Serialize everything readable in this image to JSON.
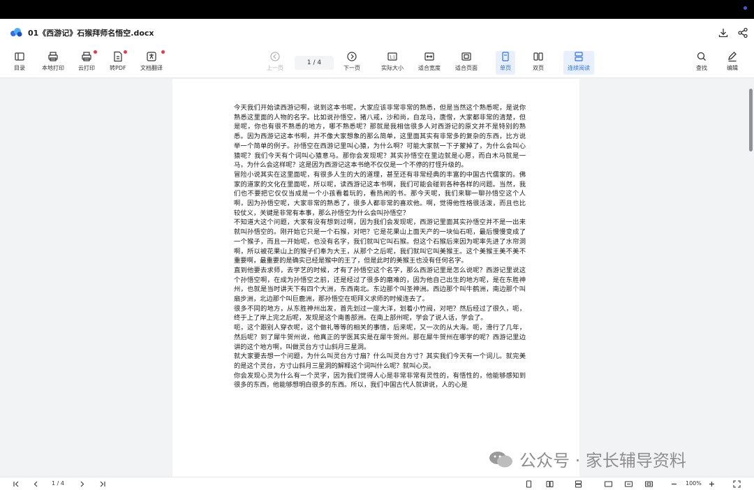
{
  "window": {
    "title": "01《西游记》石猴拜师名悟空.docx"
  },
  "toolbar": {
    "left": [
      {
        "label": "目录",
        "icon": "toc-icon"
      },
      {
        "label": "本地打印",
        "icon": "printer-icon"
      },
      {
        "label": "云打印",
        "icon": "cloud-print-icon"
      },
      {
        "label": "转PDF",
        "icon": "pdf-icon"
      },
      {
        "label": "文档翻译",
        "icon": "translate-icon"
      }
    ],
    "nav": {
      "prev_label": "上一页",
      "page_indicator": "1 / 4",
      "next_label": "下一页"
    },
    "view": [
      {
        "label": "实际大小",
        "icon": "actual-size-icon"
      },
      {
        "label": "适合宽度",
        "icon": "fit-width-icon"
      },
      {
        "label": "适合页面",
        "icon": "fit-page-icon"
      },
      {
        "label": "单页",
        "icon": "single-page-icon",
        "active": true
      },
      {
        "label": "双页",
        "icon": "double-page-icon"
      },
      {
        "label": "连续阅读",
        "icon": "continuous-icon",
        "active": true
      }
    ],
    "right": [
      {
        "label": "查找",
        "icon": "search-icon"
      },
      {
        "label": "编辑",
        "icon": "edit-icon"
      }
    ]
  },
  "document": {
    "paragraphs": [
      "今天我们开始读西游记啊，说到这本书呢，大家应该非常非常的熟悉，但是当然这个熟悉呢，是说你熟悉这里面的人物的名字。比如说孙悟空，猪八戒，沙和尚，白龙马，唐僧，大家都非常的清楚，但是呢，你也有很不熟悉的地方，哪不熟悉呢？那就是我相信很多人对西游记的原文并不是特别的熟悉。因为西游记这本书啊，并不像大家想象的那么简单，这里面其实有非常多的复杂的东西，比方说举一个简单的例子。孙悟空在西游记里叫心猿，为什么啊？可能大家就一下子蒙掉了，为什么会叫心猿呢？我们今天有个词叫心猿意马。那你会发现呢？其实孙悟空在里边就是心愿，而白木马就是一马，为什么会这样呢？这是因为西游记这本书绝不仅仅是一个不停的打怪升级的。",
      "冒险小说其实在这里面呢，有很多人生的大的道理，甚至还有非常经典的丰富的中国古代儒家的。佛家的道家的文化在里面呢，所以呢，读西游记这本书啊，我们可能会碰到各种各样的问题。当然，我们也不要把它仅仅当成是一个小孩看着玩的，看热闹的书。那今天呢，我们来聊一聊孙悟空这个人啊，因为孙悟空呢，大家非常的熟悉了，很多人都非常的喜欢他。啊，觉得他性格很活泼，而且也比较仗义，关键是非常有本事，那么孙悟空为什么会叫孙悟空？",
      "不知道大这个问题，大家有没有想到过啊，因为我们会发现呢，西游记里面其实孙悟空并不是一出来就叫孙悟空的。刚开始它只是一个石猴，对吧？它是花果山上面天产的一块仙石呃，最后慢慢变成了一个猴子，而且一开始呢，也没有名字，我们就叫它叫石猴。但这个石猴后来因为呢率先进了水帘洞啊，所以被花果山上的猴子们奉为大王，从那个之后呢，我们就叫它叫美猴王。这个美猴王美不美不重要啊，最重要的是确实已经是猴中的王了，但是此时的美猴王也没有任何名字。",
      "直到他要去求师，去学艺的时候，才有了孙悟空这个名字，那么西游记里是怎么说呢？西游记里说这个孙悟空啊，在成为孙悟空之前，还是经过了很多的磨难的，因为他自己出生的地方呢，是在东胜神州，也就是当时讲天下有四个大洲，东西南北。东边那个叫圣神洲。西边那个叫牛鹤洲，南边那个叫扇步洲，北边那个叫巨鹿洲，那孙悟空在呃拜义求师的时候连去了。",
      "很多不同的地方，从东胜神州出发，首先划过一座大洋，划着小竹阀，对吧？然后经过了很久，呃，终于上了岸上完之后呢，发现是这个南善部洲。在南上部州呢，学会了说人话，学会了。",
      "呃，这个跟别人穿衣呢，这个做礼等等的相关的事情，后来呢，又一次的从大海。呃，滑行了几年，然后呢？到了犀牛贺州说，他真正的学医其实是在犀牛贺州。那在犀牛贺州在哪学的呢？西游记里边讲的这个地方啊，叫做灵台方寸山斜月三星洞。",
      "就大家要去想一个问题，为什么叫灵台方寸扇？什么叫灵台方寸？其实我们今天有一个词儿。就完美的是这个灵台，方寸山斜月三星洞的解释这个词叫什么呢？就叫心灵。",
      "你会发现心灵为什么有一个灵字，因为我们觉得人心是非常非常有灵性的，有悟性的，他能够感知到很多的东西，他能够想明白很多的东西。所以，我们中国古代人就讲说，人的心是"
    ]
  },
  "bottombar": {
    "page_indicator": "1 / 4",
    "zoom": "100%"
  },
  "watermark": {
    "text": "公众号 · 家长辅导资料"
  },
  "colors": {
    "accent": "#2f6fed",
    "active_bg": "#e8f0fe",
    "badge": "#e63946"
  }
}
